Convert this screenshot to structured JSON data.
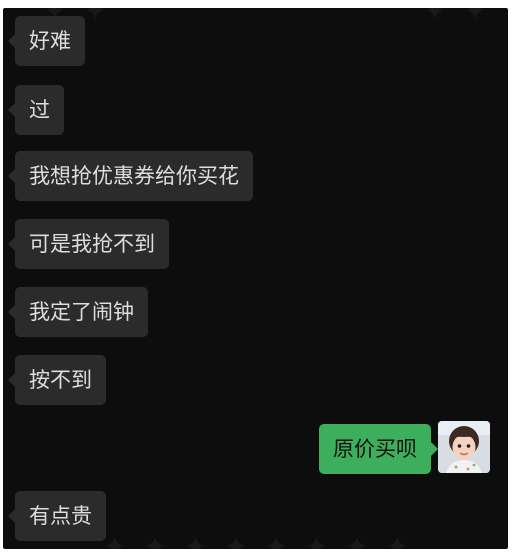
{
  "messages": [
    {
      "side": "in",
      "text": "好难"
    },
    {
      "side": "in",
      "text": "过"
    },
    {
      "side": "in",
      "text": "我想抢优惠券给你买花"
    },
    {
      "side": "in",
      "text": "可是我抢不到"
    },
    {
      "side": "in",
      "text": "我定了闹钟"
    },
    {
      "side": "in",
      "text": "按不到"
    },
    {
      "side": "out",
      "text": "原价买呗"
    },
    {
      "side": "in",
      "text": "有点贵"
    }
  ],
  "colors": {
    "background": "#0d0d0d",
    "incoming_bubble": "#2b2b2b",
    "outgoing_bubble": "#3dae5c"
  },
  "avatar": {
    "icon": "child-avatar-icon"
  }
}
